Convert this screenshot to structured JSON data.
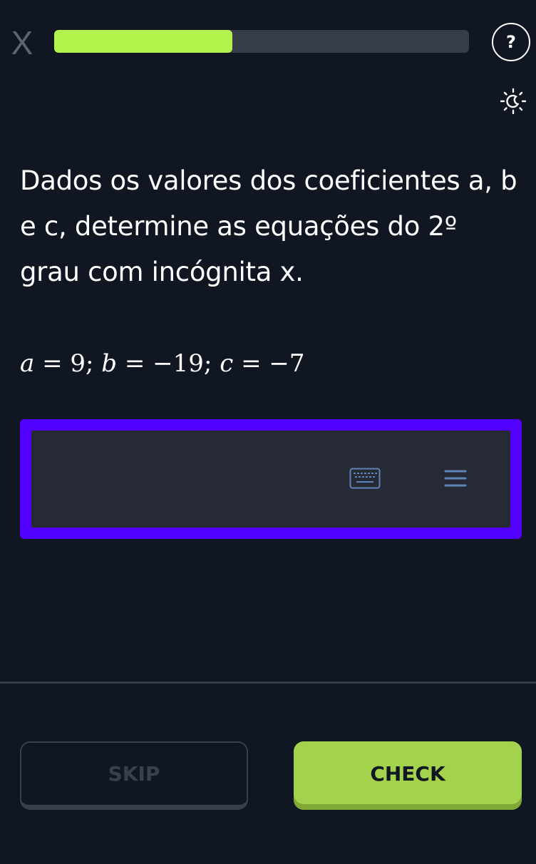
{
  "header": {
    "close_label": "X",
    "progress_fraction": 0.43,
    "help_label": "?",
    "theme_icon": "sun-moon-icon"
  },
  "question": {
    "text": "Dados os valores dos coeficientes a, b e c, determine as equações do 2º grau com incógnita x."
  },
  "equation": {
    "a_var": "a",
    "a_val": "9",
    "b_var": "b",
    "b_val": "−19",
    "c_var": "c",
    "c_val": "−7"
  },
  "answer_input": {
    "value": "",
    "keyboard_icon": "keyboard-icon",
    "menu_icon": "menu-icon"
  },
  "footer": {
    "skip_label": "SKIP",
    "check_label": "CHECK"
  },
  "colors": {
    "background": "#111722",
    "progress_fill": "#b4f24c",
    "answer_border": "#5200ff",
    "check_button": "#a3d24c"
  }
}
